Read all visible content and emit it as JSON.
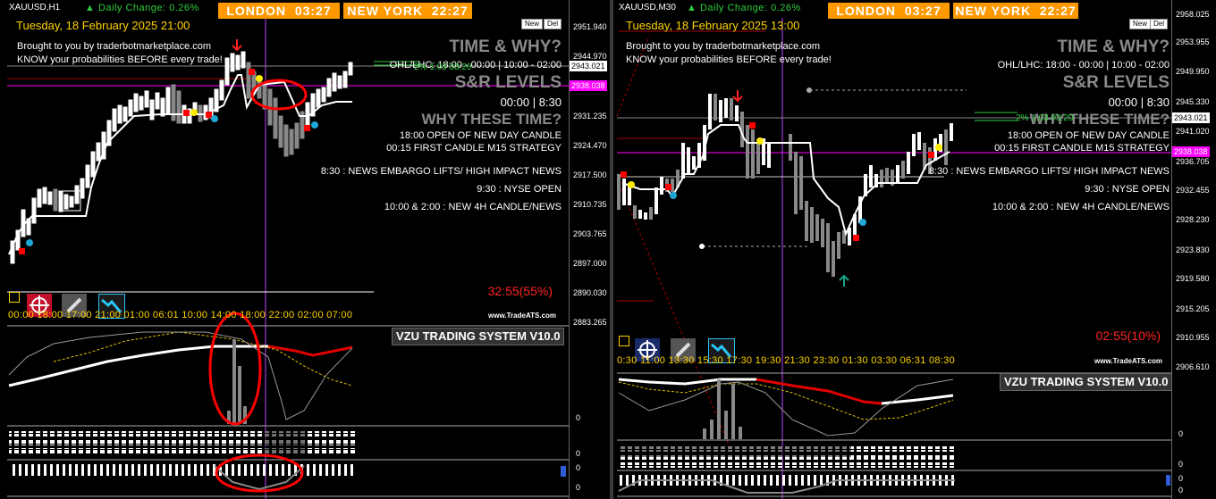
{
  "left": {
    "symbol": "XAUUSD,H1",
    "daily_change": "Daily Change: 0.26%",
    "london": {
      "label": "LONDON",
      "time": "03:27"
    },
    "newyork": {
      "label": "NEW YORK",
      "time": "22:27"
    },
    "date": "Tuesday, 18 February 2025 21:00",
    "new_btn": "New",
    "del_btn": "Del",
    "brought": "Brought to you by traderbotmarketplace.com",
    "know": "KNOW your probabilities BEFORE every trade!",
    "time_why": "TIME & WHY?",
    "ohl": "OHL/LHC: 18:00 - 00:00 | 10:00 - 02:00",
    "sr": "S&R LEVELS",
    "times": "00:00 | 8:30",
    "why_time": "WHY THESE TIME?",
    "r1": "18:00 OPEN OF NEW DAY CANDLE",
    "r2": "00:15 FIRST CANDLE M15 STRATEGY",
    "r3": "8:30 : NEWS EMBARGO LIFTS/ HIGH IMPACT NEWS",
    "r4": "9:30 : NYSE OPEN",
    "r5": "10:00 & 2:00 : NEW 4H CANDLE/NEWS",
    "green_label": "2% 1.03 03:20",
    "timer": "32:55(55%)",
    "brand": "www.TradeATS.com",
    "vzu": "VZU TRADING SYSTEM V10.0",
    "time_axis": "00:00  18:00  17:00  21:00  01:00  06:01  10:00  14:00  18:00  22:00  02:00  07:00",
    "prices": [
      "2951.940",
      "2944.970",
      "2931.235",
      "2924.470",
      "2917.500",
      "2910.735",
      "2903.765",
      "2897.000",
      "2890.030",
      "2883.265"
    ],
    "price_current": "2943.021",
    "price_magenta": "2938.038",
    "zero": "0"
  },
  "right": {
    "symbol": "XAUUSD,M30",
    "daily_change": "Daily Change: 0.26%",
    "london": {
      "label": "LONDON",
      "time": "03:27"
    },
    "newyork": {
      "label": "NEW YORK",
      "time": "22:27"
    },
    "date": "Tuesday, 18 February 2025 13:00",
    "new_btn": "New",
    "del_btn": "Del",
    "brought": "Brought to you by traderbotmarketplace.com",
    "know": "KNOW your probabilities BEFORE every trade!",
    "time_why": "TIME & WHY?",
    "ohl": "OHL/LHC: 18:00 - 00:00 | 10:00 - 02:00",
    "sr": "S&R LEVELS",
    "times": "00:00 | 8:30",
    "why_time": "WHY THESE TIME?",
    "r1": "18:00 OPEN OF NEW DAY CANDLE",
    "r2": "00:15 FIRST CANDLE M15 STRATEGY",
    "r3": "8:30 : NEWS EMBARGO LIFTS/ HIGH IMPACT NEWS",
    "r4": "9:30 : NYSE OPEN",
    "r5": "10:00 & 2:00 : NEW 4H CANDLE/NEWS",
    "green_label": "2% 1.03 03:20",
    "timer": "02:55(10%)",
    "brand": "www.TradeATS.com",
    "vzu": "VZU TRADING SYSTEM V10.0",
    "time_axis": "0:30 11:00 13:30 15:30 17:30 19:30 21:30 23:30 01:30 03:30 06:31 08:30",
    "prices": [
      "2958.025",
      "2953.955",
      "2949.950",
      "2945.330",
      "2941.020",
      "2936.705",
      "2932.455",
      "2928.230",
      "2923.830",
      "2919.580",
      "2915.205",
      "2910.955",
      "2906.610"
    ],
    "price_current": "2943.021",
    "price_magenta": "2938.038",
    "zero": "0"
  },
  "colors": {
    "session": "#ff9900",
    "date": "#ffd400",
    "green": "#2ecc40",
    "magenta": "#ff00ff",
    "red": "#ff2222",
    "grey_head": "#8a8a8a"
  }
}
